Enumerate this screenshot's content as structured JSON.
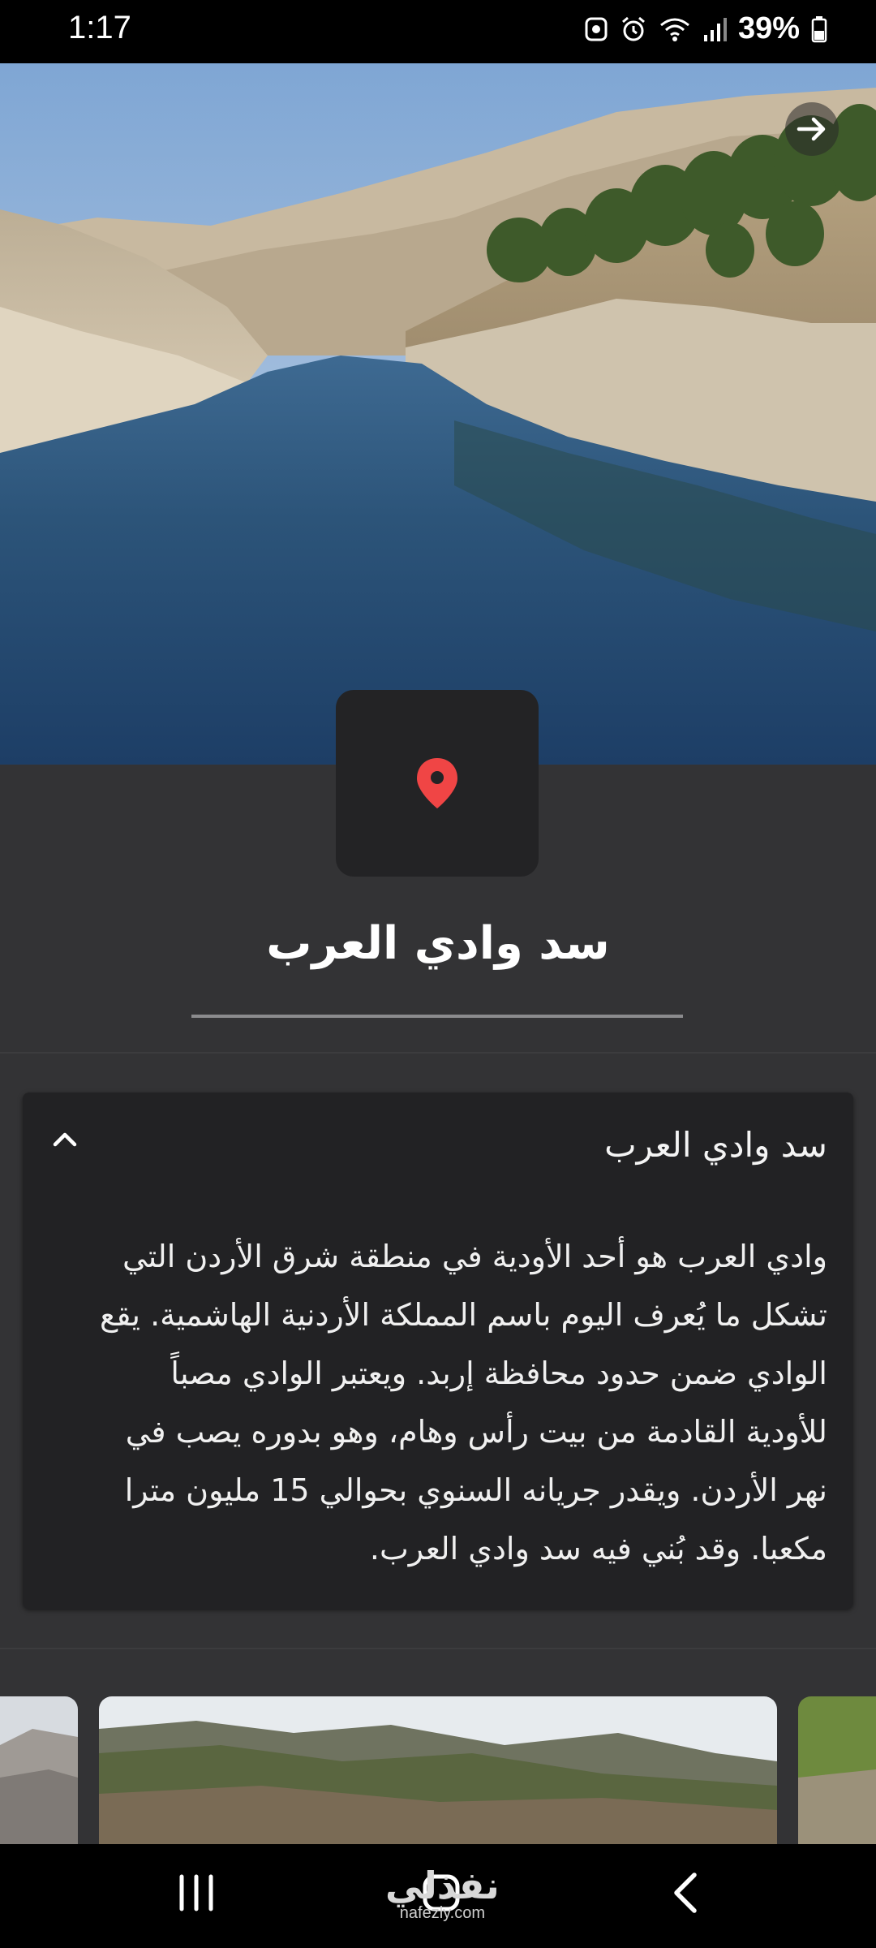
{
  "status_bar": {
    "time": "1:17",
    "battery": "39%"
  },
  "hero": {
    "next_icon": "arrow-right-icon"
  },
  "pin_icon": "map-pin-icon",
  "pin_color": "#f04545",
  "place": {
    "title": "سد وادي العرب"
  },
  "panel": {
    "title": "سد وادي العرب",
    "toggle_icon": "chevron-up-icon",
    "lines": [
      "وادي العرب هو أحد الأودية في منطقة شرق الأردن التي",
      "تشكل ما يُعرف اليوم باسم المملكة الأردنية الهاشمية. يقع",
      "الوادي ضمن حدود محافظة إربد. ويعتبر الوادي مصباً",
      "للأودية القادمة من بيت رأس وهام، وهو بدوره يصب في",
      "نهر الأردن. ويقدر جريانه السنوي بحوالي 15 مليون مترا",
      "مكعبا. وقد بُني فيه سد وادي العرب."
    ]
  },
  "watermark": {
    "text": "نفذلي",
    "sub": "nafezly.com"
  },
  "nav": {
    "recent_icon": "recent-apps-icon",
    "home_icon": "home-icon",
    "back_icon": "back-icon"
  }
}
